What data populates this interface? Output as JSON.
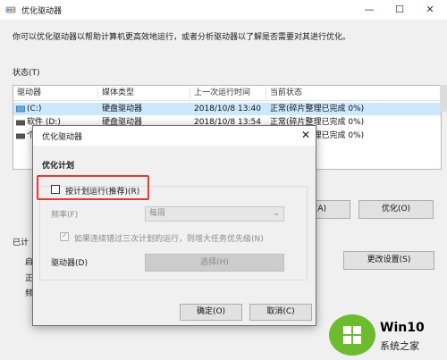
{
  "window": {
    "title": "优化驱动器",
    "description": "你可以优化驱动器以帮助计算机更高效地运行，或者分析驱动器以了解是否需要对其进行优化。",
    "status_label": "状态(T)",
    "columns": [
      "驱动器",
      "媒体类型",
      "上一次运行时间",
      "当前状态"
    ],
    "rows": [
      {
        "drive": "(C:)",
        "media": "硬盘驱动器",
        "last_run": "2018/10/8 13:40",
        "status": "正常(碎片整理已完成 0%)"
      },
      {
        "drive": "软件 (D:)",
        "media": "硬盘驱动器",
        "last_run": "2018/10/8 13:54",
        "status": "正常(碎片整理已完成 0%)"
      },
      {
        "drive": "个",
        "media": "",
        "last_run": "",
        "status": "正常(碎片整理已完成 0%)"
      }
    ],
    "analyze_partial": "(A)",
    "optimize_button": "优化(O)",
    "scheduled_partial": "已计",
    "left_frag_1": "启",
    "left_frag_2": "正",
    "left_frag_3": "频",
    "change_settings_button": "更改设置(S)"
  },
  "dialog": {
    "title": "优化驱动器",
    "section_title": "优化计划",
    "schedule_checkbox_label": "按计划运行(推荐)(R)",
    "frequency_label": "频率(F)",
    "frequency_value": "每周",
    "increase_priority_label": "如果连续错过三次计划的运行，则增大任务优先级(N)",
    "drives_label": "驱动器(D)",
    "choose_button": "选择(H)",
    "ok_button": "确定(O)",
    "cancel_button": "取消(C)"
  },
  "watermark": {
    "text1": "Win10",
    "text2": "系统之家"
  }
}
